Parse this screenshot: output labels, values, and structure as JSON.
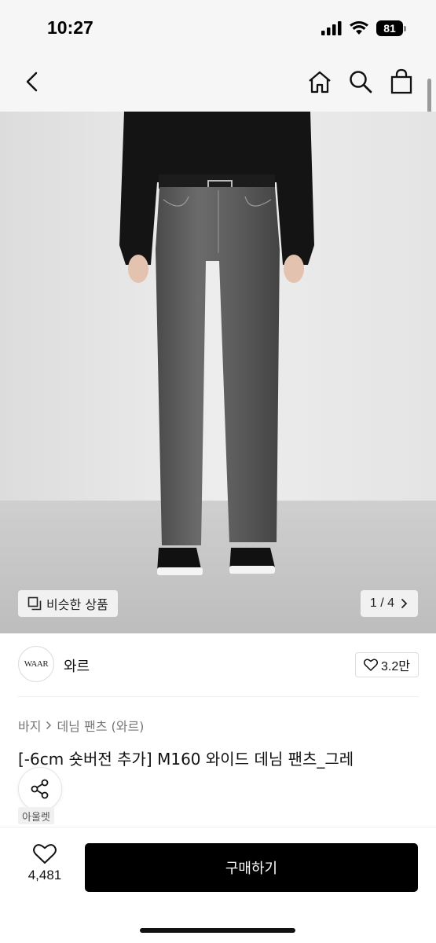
{
  "status_bar": {
    "time": "10:27",
    "battery": "81"
  },
  "nav": {
    "back_icon": "chevron-left-icon",
    "icons": [
      "home-icon",
      "search-icon",
      "shopping-bag-icon"
    ]
  },
  "gallery": {
    "similar_label": "비슷한 상품",
    "page_indicator": "1 / 4"
  },
  "brand": {
    "logo_text": "WAAR",
    "name": "와르",
    "likes": "3.2만"
  },
  "breadcrumb": {
    "category": "바지",
    "subcategory": "데님 팬츠 (와르)"
  },
  "product": {
    "title": "[-6cm 숏버전 추가] M160 와이드 데님 팬츠_그레"
  },
  "outlet_label": "아울렛",
  "bottom": {
    "wish_count": "4,481",
    "buy_label": "구매하기"
  },
  "colors": {
    "accent": "#000000",
    "background": "#ffffff",
    "header_bg": "#f6f6f6"
  }
}
